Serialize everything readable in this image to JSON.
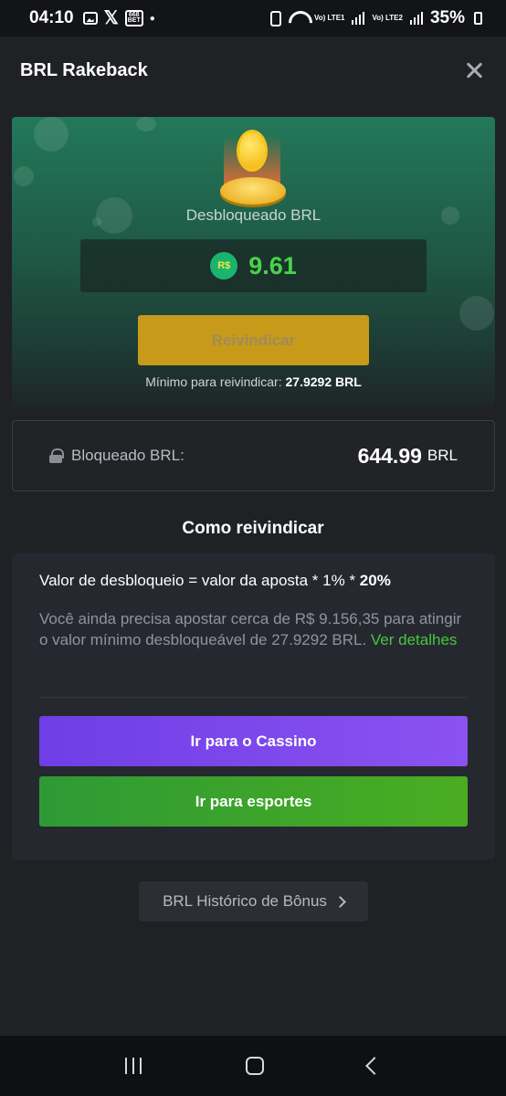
{
  "status_bar": {
    "time": "04:10",
    "bet_icon_text": "668 BET",
    "lte1": "Vo) LTE1",
    "lte2": "Vo) LTE2",
    "battery": "35%"
  },
  "header": {
    "title": "BRL Rakeback"
  },
  "hero": {
    "unlocked_label": "Desbloqueado BRL",
    "currency_badge": "R$",
    "amount": "9.61",
    "claim_button": "Reivindicar",
    "min_claim_prefix": "Mínimo para reivindicar:",
    "min_claim_value": "27.9292 BRL"
  },
  "locked": {
    "label": "Bloqueado BRL:",
    "value": "644.99",
    "unit": "BRL"
  },
  "howto": {
    "title": "Como reivindicar",
    "formula_prefix": "Valor de desbloqueio = valor da aposta * 1% *",
    "formula_bold": "20%",
    "info_text": "Você ainda precisa apostar cerca de R$ 9.156,35 para atingir o valor mínimo desbloqueável de 27.9292 BRL.",
    "details_link": "Ver detalhes",
    "casino_button": "Ir para o Cassino",
    "sports_button": "Ir para esportes"
  },
  "history": {
    "label": "BRL Histórico de Bônus"
  },
  "colors": {
    "accent_green": "#48d34b",
    "claim_gold": "#c79a1a",
    "casino_purple": "#7a45ea",
    "sports_green": "#3da42a"
  }
}
